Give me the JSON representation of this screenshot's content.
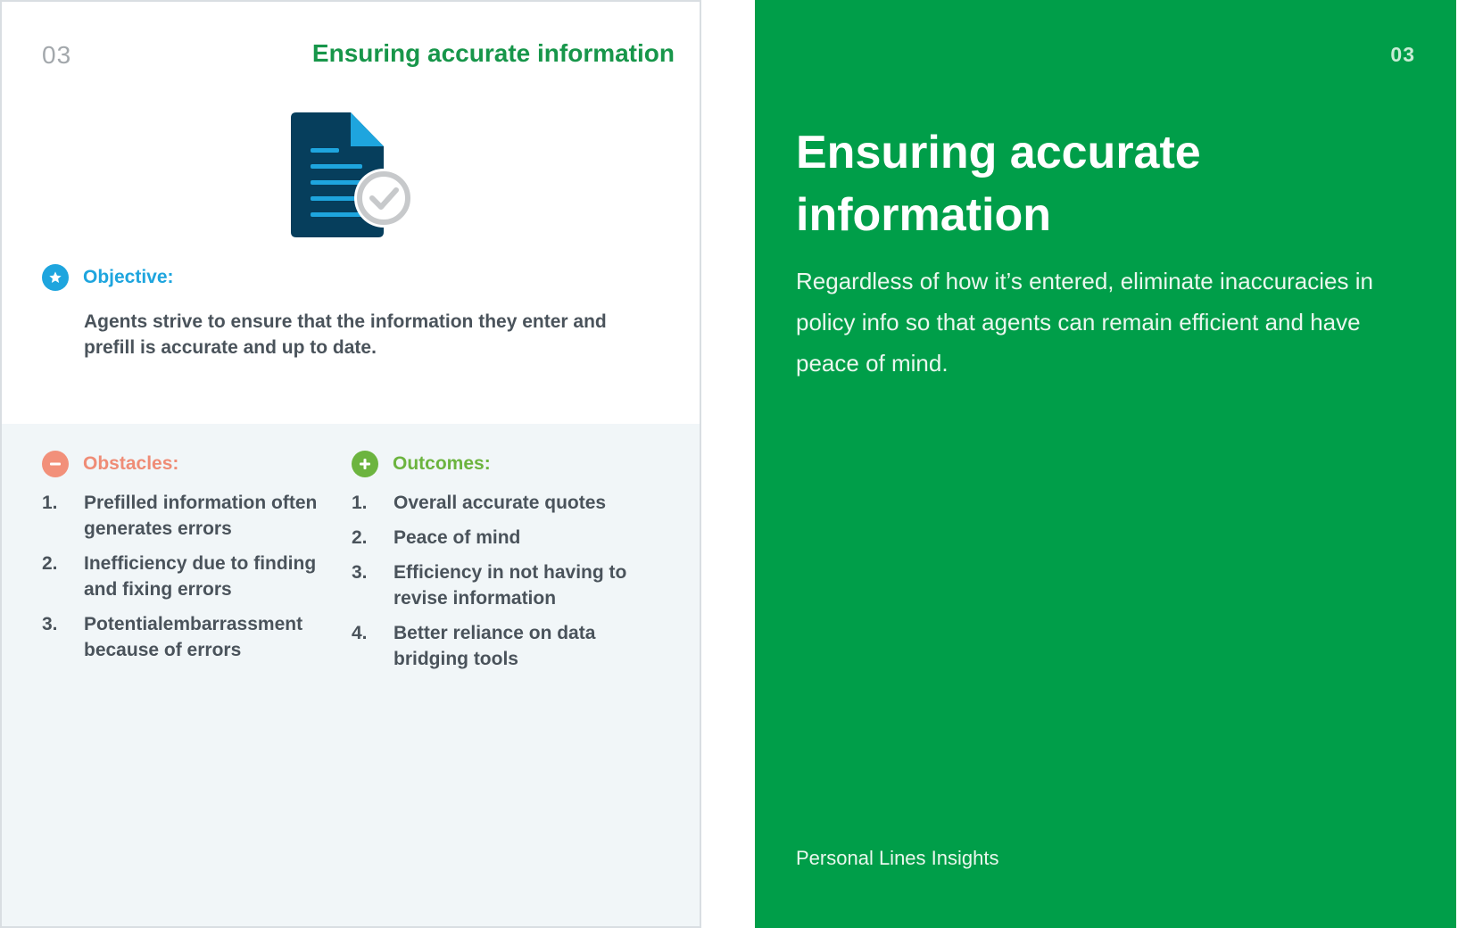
{
  "left_card": {
    "page_number": "03",
    "title": "Ensuring accurate information",
    "icon": "document-check-icon",
    "objective": {
      "label": "Objective:",
      "icon": "star-icon",
      "text": "Agents strive to ensure that the information they enter and prefill is accurate and up to date."
    },
    "obstacles": {
      "label": "Obstacles:",
      "icon": "minus-icon",
      "items": [
        {
          "num": "1.",
          "text": "Prefilled information often generates errors"
        },
        {
          "num": "2.",
          "text": "Inefficiency due to finding and fixing errors"
        },
        {
          "num": "3.",
          "text": "Potentialembarrassment because of errors"
        }
      ]
    },
    "outcomes": {
      "label": "Outcomes:",
      "icon": "plus-icon",
      "items": [
        {
          "num": "1.",
          "text": "Overall accurate quotes"
        },
        {
          "num": "2.",
          "text": "Peace of mind"
        },
        {
          "num": "3.",
          "text": "Efficiency in not having to revise information"
        },
        {
          "num": "4.",
          "text": "Better reliance on data bridging tools"
        }
      ]
    }
  },
  "right_card": {
    "page_number": "03",
    "title": "Ensuring accurate information",
    "description": "Regardless of how it’s entered, eliminate inaccuracies in policy info so that agents can remain efficient and have peace of mind.",
    "footer": "Personal Lines Insights"
  },
  "colors": {
    "brand_green": "#009e49",
    "title_green": "#17964a",
    "objective_blue": "#1ea5de",
    "obstacles_salmon": "#ef8c76",
    "outcomes_green": "#6cb43f",
    "body_text": "#4a535b"
  }
}
